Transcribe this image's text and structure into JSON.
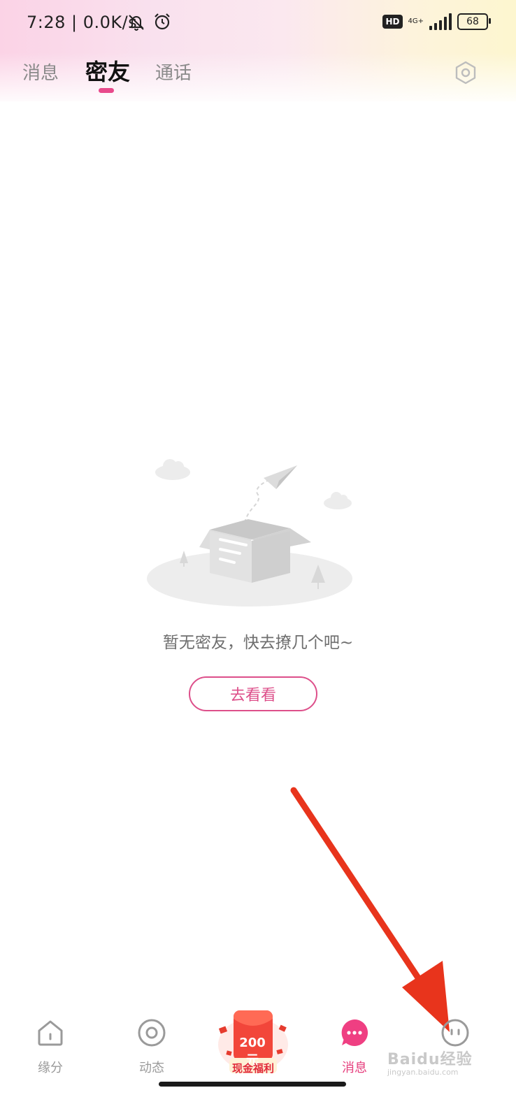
{
  "status_bar": {
    "time": "7:28 | 0.0K/s",
    "hd_badge": "HD",
    "network": "4G+",
    "battery": "68",
    "icons": [
      "mute-icon",
      "alarm-icon",
      "signal-icon",
      "battery-icon"
    ]
  },
  "tabs": [
    {
      "label": "消息"
    },
    {
      "label": "密友",
      "active": true
    },
    {
      "label": "通话"
    }
  ],
  "empty_state": {
    "message": "暂无密友，快去撩几个吧~",
    "button": "去看看"
  },
  "bottom_nav": {
    "items": [
      {
        "label": "缘分",
        "icon": "home-icon"
      },
      {
        "label": "动态",
        "icon": "moments-icon"
      },
      {
        "label": "消息",
        "icon": "message-icon",
        "active": true
      },
      {
        "label": "",
        "icon": "profile-icon"
      }
    ],
    "promo": {
      "amount": "200元",
      "label": "现金福利"
    }
  },
  "watermark": {
    "brand": "Baidu经验",
    "url": "jingyan.baidu.com"
  },
  "colors": {
    "accent": "#e63e7d",
    "arrow": "#e8341c"
  }
}
